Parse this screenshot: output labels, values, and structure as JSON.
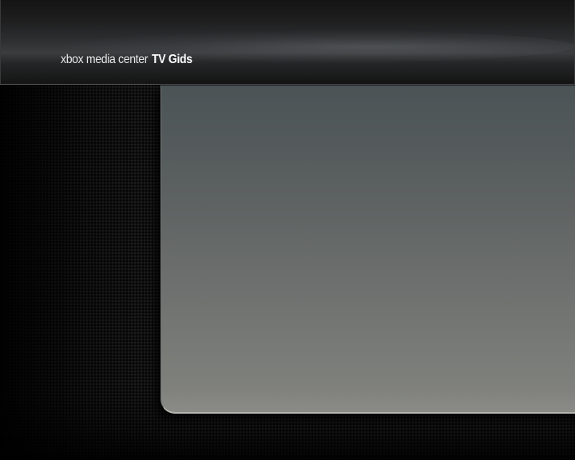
{
  "header": {
    "app_name": "xbox media center",
    "section_title": "TV Gids"
  },
  "colors": {
    "background": "#121212",
    "header_top": "#141414",
    "header_highlight": "#3a3c3e",
    "panel_top": "#4b5356",
    "panel_bottom": "#848580",
    "panel_edge": "#b5b6b0",
    "title_text": "#e6e6e6"
  }
}
